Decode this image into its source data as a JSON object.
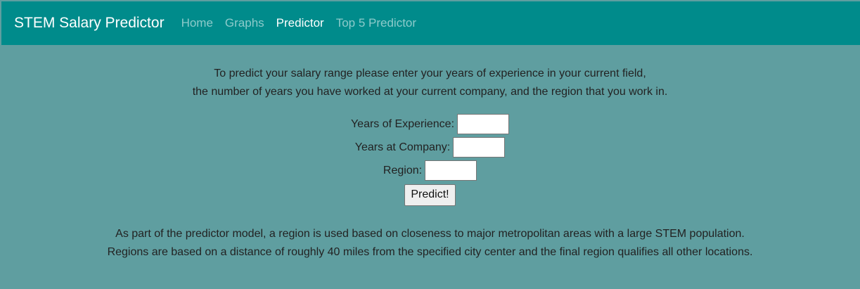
{
  "navbar": {
    "brand": "STEM Salary Predictor",
    "links": [
      {
        "label": "Home",
        "active": false
      },
      {
        "label": "Graphs",
        "active": false
      },
      {
        "label": "Predictor",
        "active": true
      },
      {
        "label": "Top 5 Predictor",
        "active": false
      }
    ],
    "color": "#008b8b"
  },
  "page": {
    "background": "#5f9ea0"
  },
  "intro": {
    "line1": "To predict your salary range please enter your years of experience in your current field,",
    "line2": "the number of years you have worked at your current company, and the region that you work in."
  },
  "form": {
    "experience_label": "Years of Experience:",
    "experience_value": "",
    "company_label": "Years at Company:",
    "company_value": "",
    "region_label": "Region:",
    "region_value": "",
    "submit_label": "Predict!"
  },
  "note": {
    "line1": "As part of the predictor model, a region is used based on closeness to major metropolitan areas with a large STEM population.",
    "line2": "Regions are based on a distance of roughly 40 miles from the specified city center and the final region qualifies all other locations."
  }
}
